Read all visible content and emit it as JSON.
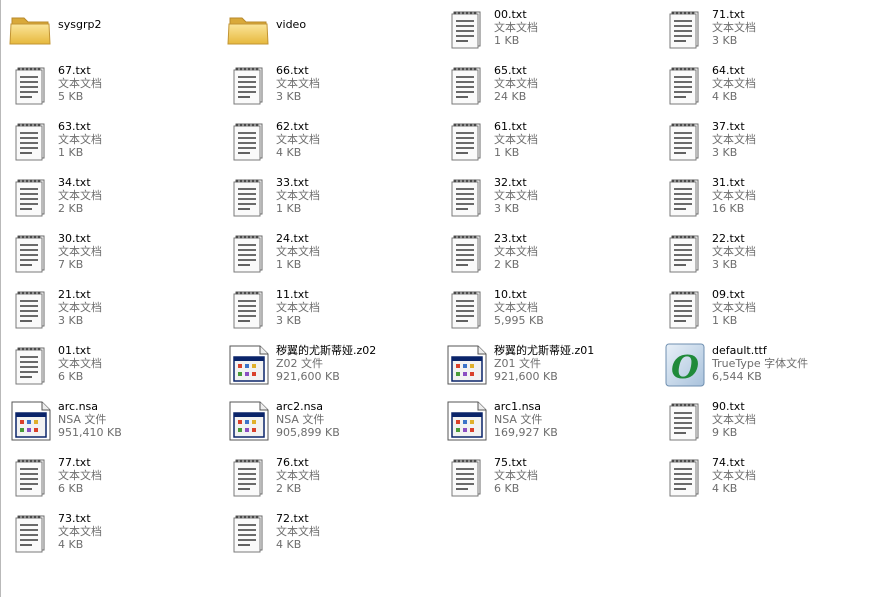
{
  "files": [
    {
      "name": "sysgrp2",
      "kind": "folder",
      "type": "",
      "size": ""
    },
    {
      "name": "video",
      "kind": "folder",
      "type": "",
      "size": ""
    },
    {
      "name": "00.txt",
      "kind": "txt",
      "type": "文本文档",
      "size": "1 KB"
    },
    {
      "name": "71.txt",
      "kind": "txt",
      "type": "文本文档",
      "size": "3 KB"
    },
    {
      "name": "67.txt",
      "kind": "txt",
      "type": "文本文档",
      "size": "5 KB"
    },
    {
      "name": "66.txt",
      "kind": "txt",
      "type": "文本文档",
      "size": "3 KB"
    },
    {
      "name": "65.txt",
      "kind": "txt",
      "type": "文本文档",
      "size": "24 KB"
    },
    {
      "name": "64.txt",
      "kind": "txt",
      "type": "文本文档",
      "size": "4 KB"
    },
    {
      "name": "63.txt",
      "kind": "txt",
      "type": "文本文档",
      "size": "1 KB"
    },
    {
      "name": "62.txt",
      "kind": "txt",
      "type": "文本文档",
      "size": "4 KB"
    },
    {
      "name": "61.txt",
      "kind": "txt",
      "type": "文本文档",
      "size": "1 KB"
    },
    {
      "name": "37.txt",
      "kind": "txt",
      "type": "文本文档",
      "size": "3 KB"
    },
    {
      "name": "34.txt",
      "kind": "txt",
      "type": "文本文档",
      "size": "2 KB"
    },
    {
      "name": "33.txt",
      "kind": "txt",
      "type": "文本文档",
      "size": "1 KB"
    },
    {
      "name": "32.txt",
      "kind": "txt",
      "type": "文本文档",
      "size": "3 KB"
    },
    {
      "name": "31.txt",
      "kind": "txt",
      "type": "文本文档",
      "size": "16 KB"
    },
    {
      "name": "30.txt",
      "kind": "txt",
      "type": "文本文档",
      "size": "7 KB"
    },
    {
      "name": "24.txt",
      "kind": "txt",
      "type": "文本文档",
      "size": "1 KB"
    },
    {
      "name": "23.txt",
      "kind": "txt",
      "type": "文本文档",
      "size": "2 KB"
    },
    {
      "name": "22.txt",
      "kind": "txt",
      "type": "文本文档",
      "size": "3 KB"
    },
    {
      "name": "21.txt",
      "kind": "txt",
      "type": "文本文档",
      "size": "3 KB"
    },
    {
      "name": "11.txt",
      "kind": "txt",
      "type": "文本文档",
      "size": "3 KB"
    },
    {
      "name": "10.txt",
      "kind": "txt",
      "type": "文本文档",
      "size": "5,995 KB"
    },
    {
      "name": "09.txt",
      "kind": "txt",
      "type": "文本文档",
      "size": "1 KB"
    },
    {
      "name": "01.txt",
      "kind": "txt",
      "type": "文本文档",
      "size": "6 KB"
    },
    {
      "name": "秽翼的尤斯蒂娅.z02",
      "kind": "archive",
      "type": "Z02 文件",
      "size": "921,600 KB"
    },
    {
      "name": "秽翼的尤斯蒂娅.z01",
      "kind": "archive",
      "type": "Z01 文件",
      "size": "921,600 KB"
    },
    {
      "name": "default.ttf",
      "kind": "font",
      "type": "TrueType 字体文件",
      "size": "6,544 KB"
    },
    {
      "name": "arc.nsa",
      "kind": "archive",
      "type": "NSA 文件",
      "size": "951,410 KB"
    },
    {
      "name": "arc2.nsa",
      "kind": "archive",
      "type": "NSA 文件",
      "size": "905,899 KB"
    },
    {
      "name": "arc1.nsa",
      "kind": "archive",
      "type": "NSA 文件",
      "size": "169,927 KB"
    },
    {
      "name": "90.txt",
      "kind": "txt",
      "type": "文本文档",
      "size": "9 KB"
    },
    {
      "name": "77.txt",
      "kind": "txt",
      "type": "文本文档",
      "size": "6 KB"
    },
    {
      "name": "76.txt",
      "kind": "txt",
      "type": "文本文档",
      "size": "2 KB"
    },
    {
      "name": "75.txt",
      "kind": "txt",
      "type": "文本文档",
      "size": "6 KB"
    },
    {
      "name": "74.txt",
      "kind": "txt",
      "type": "文本文档",
      "size": "4 KB"
    },
    {
      "name": "73.txt",
      "kind": "txt",
      "type": "文本文档",
      "size": "4 KB"
    },
    {
      "name": "72.txt",
      "kind": "txt",
      "type": "文本文档",
      "size": "4 KB"
    }
  ],
  "colors": {
    "folder": "#f3d269",
    "font_glyph": "#1f8a3a",
    "archive_frame": "#0a246a",
    "meta_text": "#6d6d6d"
  }
}
